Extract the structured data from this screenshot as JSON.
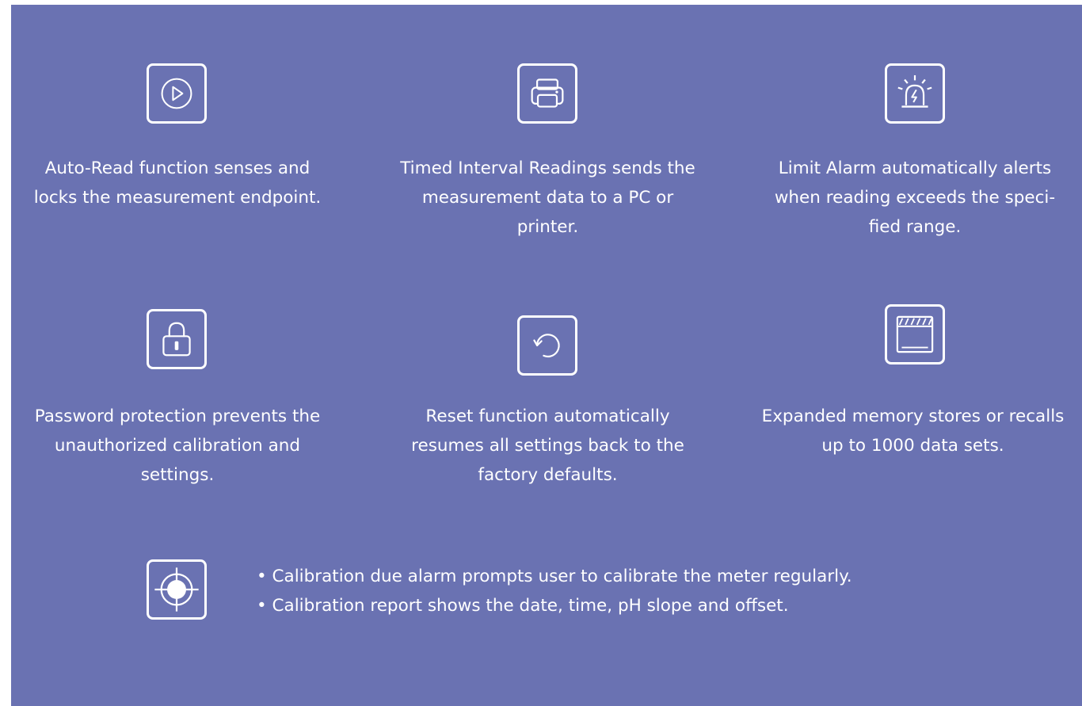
{
  "features": [
    {
      "icon": "play-circle-icon",
      "lines": [
        "Auto-Read function senses and",
        "locks the measurement endpoint."
      ]
    },
    {
      "icon": "printer-icon",
      "lines": [
        "Timed Interval Readings sends the",
        "measurement data to a PC or",
        "printer."
      ]
    },
    {
      "icon": "alarm-siren-icon",
      "lines": [
        "Limit Alarm automatically alerts",
        "when reading exceeds the speci-",
        "fied range."
      ]
    },
    {
      "icon": "lock-icon",
      "lines": [
        "Password protection prevents the",
        "unauthorized calibration and",
        "settings."
      ]
    },
    {
      "icon": "reset-icon",
      "lines": [
        "Reset function automatically",
        "resumes all settings back to the",
        "factory defaults."
      ]
    },
    {
      "icon": "memory-icon",
      "lines": [
        "Expanded memory stores or recalls",
        "up to 1000 data sets."
      ]
    }
  ],
  "calibration": {
    "icon": "target-icon",
    "bullets": [
      "• Calibration due alarm prompts user to calibrate the meter regularly.",
      "• Calibration report shows the date, time, pH slope and offset."
    ]
  },
  "colors": {
    "panel_background": "#6a72b2",
    "foreground": "#ffffff"
  }
}
